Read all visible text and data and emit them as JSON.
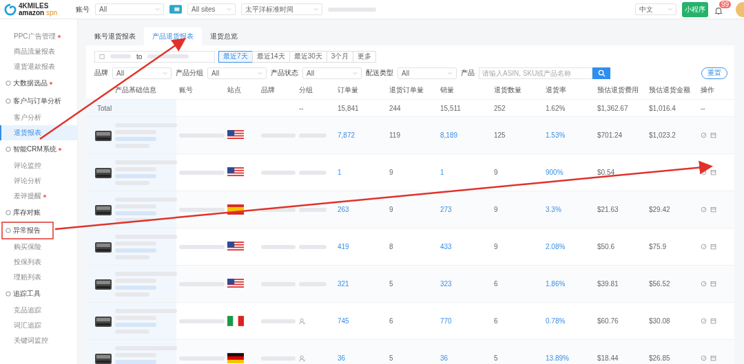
{
  "header": {
    "logo_top": "4KMILES",
    "logo_bottom": "amazon",
    "logo_suffix": "spn",
    "account_label": "账号",
    "account_value": "All",
    "sites_value": "All sites",
    "timezone": "太平洋标准时间",
    "language": "中文",
    "mini_program": "小程序",
    "notification_count": "99"
  },
  "sidebar": {
    "items": [
      {
        "label": "PPC广告管理",
        "kind": "sub",
        "dot": true,
        "selected": false
      },
      {
        "label": "商品流量报表",
        "kind": "sub",
        "dot": false,
        "selected": false
      },
      {
        "label": "退货退款报表",
        "kind": "sub",
        "dot": false,
        "selected": false
      },
      {
        "label": "大数据选品",
        "kind": "group",
        "dot": true,
        "selected": false
      },
      {
        "label": "客户与订单分析",
        "kind": "group",
        "dot": false,
        "selected": false
      },
      {
        "label": "客户分析",
        "kind": "sub",
        "dot": false,
        "selected": false
      },
      {
        "label": "退货报表",
        "kind": "sub",
        "dot": false,
        "selected": true
      },
      {
        "label": "智能CRM系统",
        "kind": "group",
        "dot": true,
        "selected": false
      },
      {
        "label": "评论监控",
        "kind": "sub",
        "dot": false,
        "selected": false
      },
      {
        "label": "评论分析",
        "kind": "sub",
        "dot": false,
        "selected": false
      },
      {
        "label": "差评提醒",
        "kind": "sub",
        "dot": true,
        "selected": false
      },
      {
        "label": "库存对账",
        "kind": "group",
        "dot": false,
        "selected": false
      },
      {
        "label": "异常报告",
        "kind": "group",
        "dot": false,
        "selected": false
      },
      {
        "label": "购买保险",
        "kind": "sub",
        "dot": false,
        "selected": false
      },
      {
        "label": "投保列表",
        "kind": "sub",
        "dot": false,
        "selected": false
      },
      {
        "label": "理赔列表",
        "kind": "sub",
        "dot": false,
        "selected": false
      },
      {
        "label": "追踪工具",
        "kind": "group",
        "dot": false,
        "selected": false
      },
      {
        "label": "竞品追踪",
        "kind": "sub",
        "dot": false,
        "selected": false
      },
      {
        "label": "词汇追踪",
        "kind": "sub",
        "dot": false,
        "selected": false
      },
      {
        "label": "关键词监控",
        "kind": "sub",
        "dot": false,
        "selected": false
      }
    ]
  },
  "tabs": [
    {
      "label": "账号退货报表",
      "selected": false
    },
    {
      "label": "产品退货报表",
      "selected": true
    },
    {
      "label": "退货总览",
      "selected": false
    }
  ],
  "date_range": {
    "separator": "to",
    "presets": [
      {
        "label": "最近7天",
        "selected": true
      },
      {
        "label": "最近14天",
        "selected": false
      },
      {
        "label": "最近30天",
        "selected": false
      },
      {
        "label": "3个月",
        "selected": false
      },
      {
        "label": "更多",
        "selected": false
      }
    ]
  },
  "filters": [
    {
      "label": "品牌",
      "value": "All"
    },
    {
      "label": "产品分组",
      "value": "All"
    },
    {
      "label": "产品状态",
      "value": "All"
    },
    {
      "label": "配送类型",
      "value": "All"
    }
  ],
  "product_search": {
    "label": "产品",
    "placeholder": "请输入ASIN, SKU或产品名称"
  },
  "reset_button": "重置",
  "table": {
    "columns": [
      "产品基础信息",
      "账号",
      "站点",
      "品牌",
      "分组",
      "订单量",
      "退货订单量",
      "销量",
      "退货数量",
      "退货率",
      "预估退货费用",
      "预估退货金额",
      "操作"
    ],
    "total": {
      "label": "Total",
      "group": "--",
      "values": [
        "15,841",
        "244",
        "15,511",
        "252",
        "1.62%",
        "$1,362.67",
        "$1,016.4"
      ],
      "actions": "--"
    },
    "rows": [
      {
        "kind": "us",
        "group_icon": false,
        "values": [
          "7,872",
          "119",
          "8,189",
          "125",
          "1.53%",
          "$701.24",
          "$1,023.2"
        ]
      },
      {
        "kind": "us",
        "group_icon": false,
        "values": [
          "1",
          "9",
          "1",
          "9",
          "900%",
          "$0.54"
        ]
      },
      {
        "kind": "es",
        "group_icon": false,
        "values": [
          "263",
          "9",
          "273",
          "9",
          "3.3%",
          "$21.63",
          "$29.42"
        ]
      },
      {
        "kind": "us",
        "group_icon": false,
        "values": [
          "419",
          "8",
          "433",
          "9",
          "2.08%",
          "$50.6",
          "$75.9"
        ]
      },
      {
        "kind": "us",
        "group_icon": false,
        "values": [
          "321",
          "5",
          "323",
          "6",
          "1.86%",
          "$39.81",
          "$56.52"
        ]
      },
      {
        "kind": "it",
        "group_icon": true,
        "values": [
          "745",
          "6",
          "770",
          "6",
          "0.78%",
          "$60.76",
          "$30.08"
        ]
      },
      {
        "kind": "de",
        "group_icon": true,
        "values": [
          "36",
          "5",
          "36",
          "5",
          "13.89%",
          "$18.44",
          "$26.85"
        ]
      }
    ]
  }
}
